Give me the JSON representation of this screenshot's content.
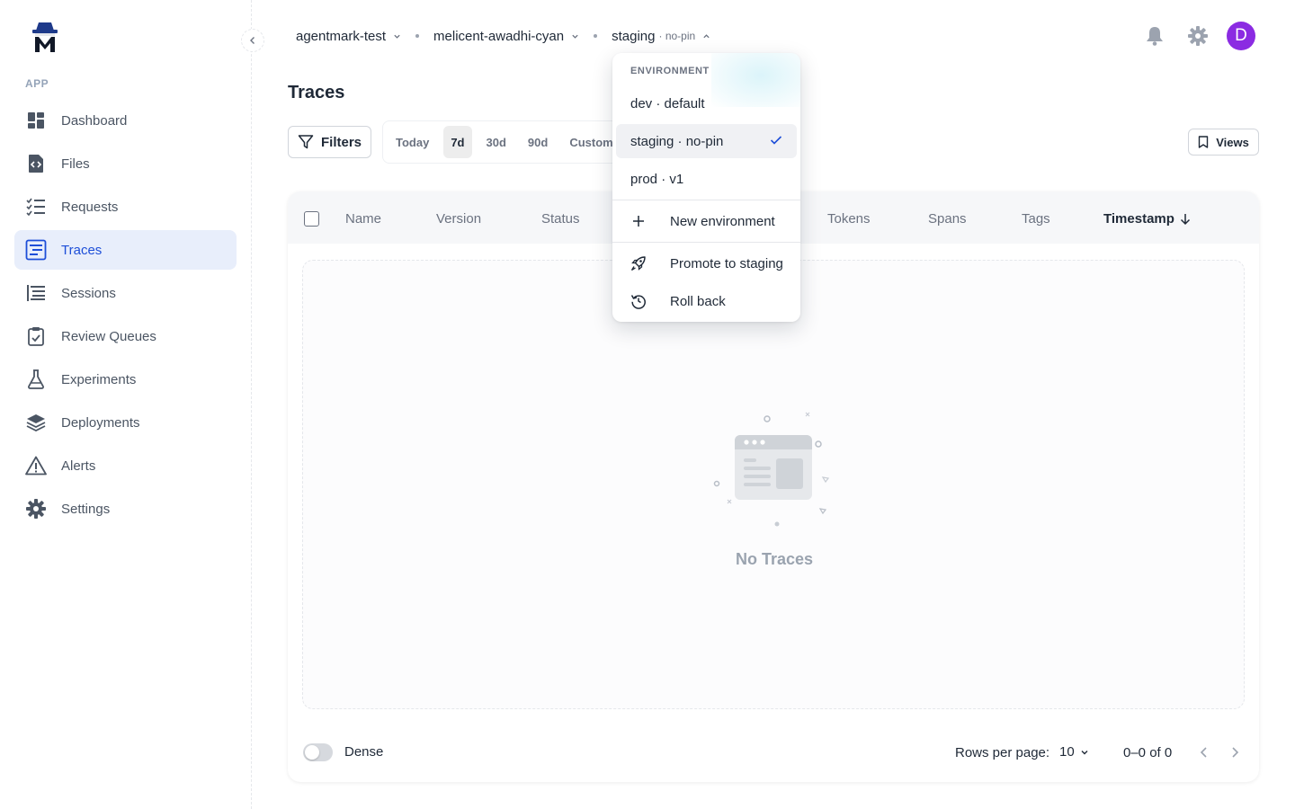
{
  "sidebar": {
    "section_label": "APP",
    "items": [
      {
        "label": "Dashboard",
        "icon": "dashboard-icon"
      },
      {
        "label": "Files",
        "icon": "file-code-icon"
      },
      {
        "label": "Requests",
        "icon": "list-check-icon"
      },
      {
        "label": "Traces",
        "icon": "traces-icon",
        "active": true
      },
      {
        "label": "Sessions",
        "icon": "sessions-icon"
      },
      {
        "label": "Review Queues",
        "icon": "clipboard-check-icon"
      },
      {
        "label": "Experiments",
        "icon": "flask-icon"
      },
      {
        "label": "Deployments",
        "icon": "layers-icon"
      },
      {
        "label": "Alerts",
        "icon": "warning-icon"
      },
      {
        "label": "Settings",
        "icon": "gear-icon"
      }
    ]
  },
  "topbar": {
    "org": "agentmark-test",
    "project": "melicent-awadhi-cyan",
    "environment": "staging",
    "environment_sub": "· no-pin",
    "avatar_initial": "D"
  },
  "page": {
    "title": "Traces",
    "filters_label": "Filters",
    "ranges": [
      "Today",
      "7d",
      "30d",
      "90d",
      "Custom"
    ],
    "active_range": "7d",
    "views_label": "Views"
  },
  "table": {
    "columns": [
      "Name",
      "Version",
      "Status",
      "Tokens",
      "Spans",
      "Tags",
      "Timestamp"
    ],
    "empty_text": "No Traces"
  },
  "footer": {
    "dense_label": "Dense",
    "rows_per_page_label": "Rows per page:",
    "rows_per_page_value": "10",
    "page_info": "0–0 of 0"
  },
  "dropdown": {
    "header": "ENVIRONMENT",
    "options": [
      {
        "label": "dev · default"
      },
      {
        "label": "staging · no-pin",
        "selected": true
      },
      {
        "label": "prod · v1"
      }
    ],
    "new_env_label": "New environment",
    "promote_label": "Promote to staging",
    "rollback_label": "Roll back"
  },
  "colors": {
    "accent": "#1d4ed8",
    "active_bg": "#e8eefb",
    "avatar": "#8b2be2"
  }
}
